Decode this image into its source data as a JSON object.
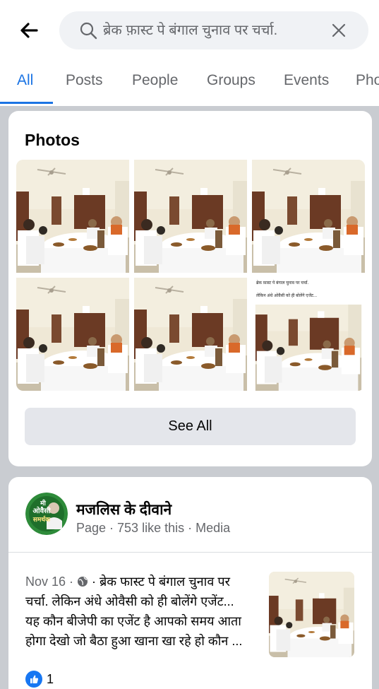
{
  "search": {
    "query": "ब्रेक फ़ास्ट पे बंगाल चुनाव पर चर्चा."
  },
  "tabs": [
    {
      "label": "All",
      "active": true
    },
    {
      "label": "Posts"
    },
    {
      "label": "People"
    },
    {
      "label": "Groups"
    },
    {
      "label": "Events"
    },
    {
      "label": "Pho"
    }
  ],
  "photos": {
    "title": "Photos",
    "count": 6,
    "overlay_caption_line1": "ब्रेक फ़ास्ट पे बंगाल चुनाव पर चर्चा.",
    "overlay_caption_line2": "लेकिन अंधे ओवैसी को ही बोलेंगे एजेंट...",
    "see_all_label": "See All"
  },
  "result": {
    "page_name": "मजलिस के दीवाने",
    "page_meta": "Page · 753 like this · Media",
    "avatar_line1": "मी",
    "avatar_line2": "ओवैसी",
    "avatar_line3": "समर्थक",
    "post_date": "Nov 16 · ",
    "post_line1_text": " · ब्रेक फास्ट पे बंगाल चुनाव पर",
    "post_line2": "चर्चा.  लेकिन अंधे ओवैसी को ही बोलेंगे एजेंट...",
    "post_line3": "यह कौन बीजेपी का एजेंट है आपको समय आता",
    "post_line4": "होगा देखो जो बैठा हुआ खाना खा रहे हो कौन ...",
    "like_count": "1"
  },
  "colors": {
    "accent": "#1b74e4",
    "like": "#1877f2",
    "muted": "#65676b"
  },
  "icons": [
    "back-arrow-icon",
    "search-icon",
    "close-icon",
    "globe-icon",
    "like-icon"
  ]
}
